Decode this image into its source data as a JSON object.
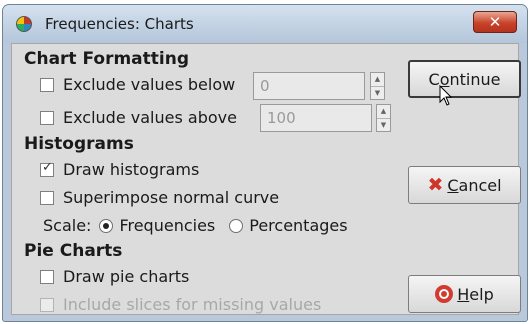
{
  "window": {
    "title": "Frequencies: Charts",
    "close_symbol": "✕"
  },
  "chart_formatting": {
    "heading": "Chart Formatting",
    "exclude_below": {
      "label": "Exclude values below",
      "checked": false,
      "value": "0"
    },
    "exclude_above": {
      "label": "Exclude values above",
      "checked": false,
      "value": "100"
    }
  },
  "histograms": {
    "heading": "Histograms",
    "draw_histograms": {
      "label": "Draw histograms",
      "checked": true
    },
    "superimpose": {
      "label": "Superimpose normal curve",
      "checked": false
    },
    "scale_label": "Scale:",
    "scale_options": [
      {
        "label": "Frequencies",
        "selected": true
      },
      {
        "label": "Percentages",
        "selected": false
      }
    ]
  },
  "pie_charts": {
    "heading": "Pie Charts",
    "draw_pie": {
      "label": "Draw pie charts",
      "checked": false
    },
    "include_slices": {
      "label": "Include slices for missing values",
      "checked": false,
      "enabled": false
    }
  },
  "buttons": {
    "continue_pre": "C",
    "continue_ul": "o",
    "continue_post": "ntinue",
    "cancel_ul": "C",
    "cancel_post": "ancel",
    "help_ul": "H",
    "help_post": "elp"
  },
  "icons": {
    "app": "spss-app-icon",
    "close": "close-icon",
    "cancel": "cancel-x-icon",
    "help": "help-lifebuoy-icon",
    "cursor": "mouse-pointer-icon"
  }
}
